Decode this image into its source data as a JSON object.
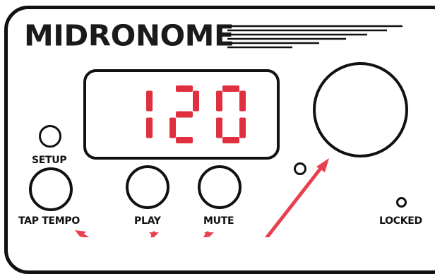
{
  "brand": {
    "name": "MIDRONOME"
  },
  "display": {
    "value": "120",
    "digit_color": "#e0303f"
  },
  "controls": {
    "setup_label": "SETUP",
    "tap_tempo_label": "TAP TEMPO",
    "play_label": "PLAY",
    "mute_label": "MUTE",
    "locked_label": "LOCKED"
  },
  "colors": {
    "outline": "#111111",
    "arrow": "#e8404f",
    "background": "#ffffff"
  }
}
